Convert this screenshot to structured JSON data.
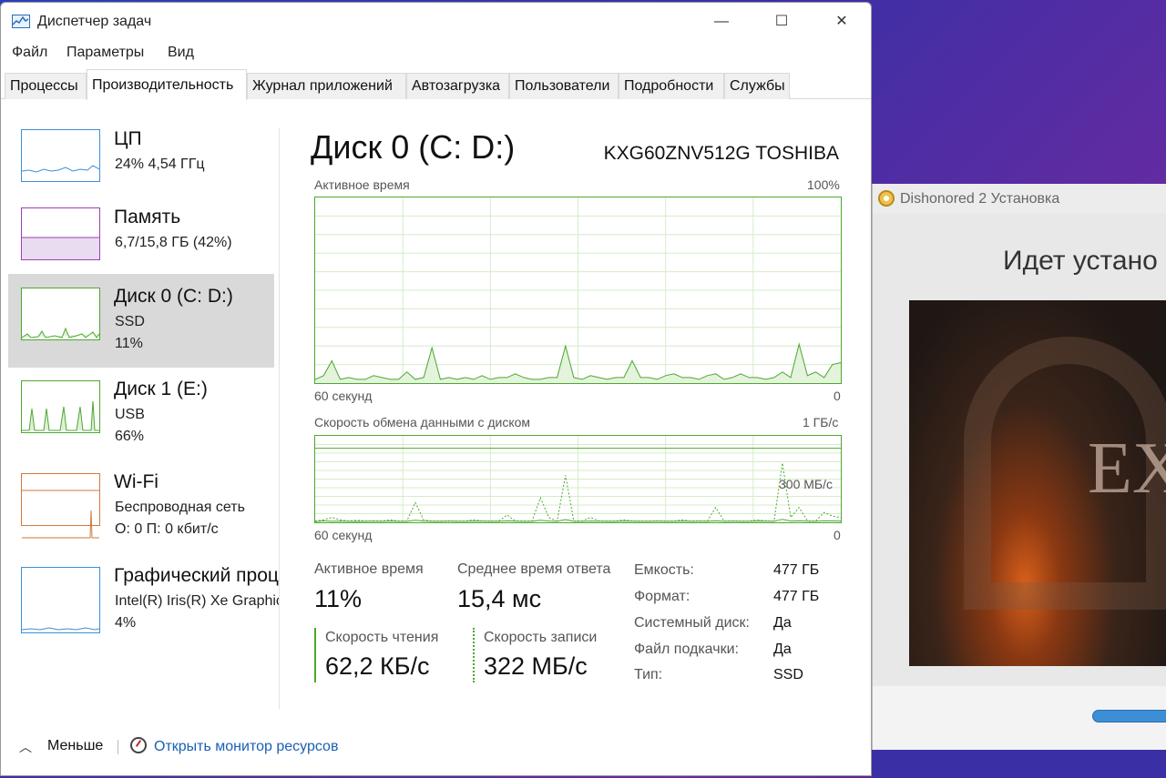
{
  "window": {
    "title": "Диспетчер задач",
    "controls": {
      "minimize": "—",
      "maximize": "☐",
      "close": "✕"
    }
  },
  "menu": [
    "Файл",
    "Параметры",
    "Вид"
  ],
  "tabs": [
    {
      "label": "Процессы",
      "active": false
    },
    {
      "label": "Производительность",
      "active": true
    },
    {
      "label": "Журнал приложений",
      "active": false
    },
    {
      "label": "Автозагрузка",
      "active": false
    },
    {
      "label": "Пользователи",
      "active": false
    },
    {
      "label": "Подробности",
      "active": false
    },
    {
      "label": "Службы",
      "active": false
    }
  ],
  "sidebar": {
    "items": [
      {
        "name": "ЦП",
        "line1": "24%  4,54 ГГц",
        "line2": "",
        "color": "#3c8fd4",
        "selected": false
      },
      {
        "name": "Память",
        "line1": "6,7/15,8 ГБ (42%)",
        "line2": "",
        "color": "#9b3fb5",
        "selected": false
      },
      {
        "name": "Диск 0 (C: D:)",
        "line1": "SSD",
        "line2": "11%",
        "color": "#4ca82e",
        "selected": true
      },
      {
        "name": "Диск 1 (E:)",
        "line1": "USB",
        "line2": "66%",
        "color": "#4ca82e",
        "selected": false
      },
      {
        "name": "Wi-Fi",
        "line1": "Беспроводная сеть",
        "line2": "О: 0  П: 0 кбит/с",
        "color": "#d27a3a",
        "selected": false
      },
      {
        "name": "Графический процессор",
        "line1": "Intel(R) Iris(R) Xe Graphics",
        "line2": "4%",
        "color": "#3c8fd4",
        "selected": false
      }
    ]
  },
  "main": {
    "title": "Диск 0 (C: D:)",
    "model": "KXG60ZNV512G TOSHIBA",
    "graph1": {
      "label": "Активное время",
      "max": "100%",
      "time": "60 секунд",
      "min": "0",
      "values": [
        2,
        4,
        12,
        2,
        3,
        2,
        2,
        4,
        3,
        2,
        2,
        6,
        2,
        3,
        19,
        2,
        3,
        2,
        3,
        2,
        4,
        2,
        3,
        3,
        5,
        3,
        2,
        2,
        3,
        3,
        20,
        3,
        2,
        4,
        3,
        2,
        3,
        3,
        12,
        3,
        3,
        2,
        4,
        5,
        3,
        3,
        2,
        4,
        5,
        2,
        3,
        5,
        3,
        3,
        2,
        3,
        6,
        3,
        21,
        4,
        6,
        3,
        10,
        11
      ],
      "ylim": [
        0,
        100
      ]
    },
    "graph2": {
      "label": "Скорость обмена данными с диском",
      "max": "1 ГБ/с",
      "mid": "300 МБ/с",
      "time": "60 секунд",
      "min": "0",
      "read": [
        15,
        30,
        20,
        25,
        20,
        18,
        20,
        22,
        20,
        25,
        20,
        20,
        40,
        25,
        20,
        20,
        22,
        20,
        20,
        25,
        22,
        20,
        20,
        30,
        22,
        20,
        20,
        40,
        25,
        20,
        55,
        20,
        20,
        25,
        22,
        20,
        20,
        25,
        22,
        20,
        20,
        22,
        20,
        20,
        25,
        20,
        22,
        20,
        30,
        20,
        22,
        20,
        20,
        25,
        22,
        20,
        60,
        25,
        30,
        22,
        20,
        30,
        28,
        26
      ],
      "write": [
        5,
        10,
        20,
        10,
        5,
        8,
        5,
        6,
        5,
        10,
        5,
        5,
        80,
        10,
        5,
        5,
        6,
        5,
        5,
        10,
        6,
        5,
        5,
        30,
        6,
        5,
        5,
        100,
        20,
        5,
        190,
        5,
        5,
        20,
        6,
        5,
        5,
        10,
        6,
        5,
        5,
        6,
        5,
        5,
        10,
        5,
        6,
        5,
        60,
        5,
        6,
        5,
        5,
        10,
        6,
        5,
        240,
        20,
        60,
        6,
        5,
        40,
        25,
        20
      ],
      "ylim_mb": [
        0,
        350
      ]
    },
    "stats": {
      "active_time_label": "Активное время",
      "active_time_value": "11%",
      "response_label": "Среднее время ответа",
      "response_value": "15,4 мс",
      "read_label": "Скорость чтения",
      "read_value": "62,2 КБ/с",
      "write_label": "Скорость записи",
      "write_value": "322 МБ/с"
    },
    "properties": [
      {
        "label": "Емкость:",
        "value": "477 ГБ"
      },
      {
        "label": "Формат:",
        "value": "477 ГБ"
      },
      {
        "label": "Системный диск:",
        "value": "Да"
      },
      {
        "label": "Файл подкачки:",
        "value": "Да"
      },
      {
        "label": "Тип:",
        "value": "SSD"
      }
    ]
  },
  "footer": {
    "less": "Меньше",
    "resource_monitor": "Открыть монитор ресурсов"
  },
  "installer": {
    "title": "Dishonored 2 Установка",
    "heading": "Идет устано",
    "art_text": "EX",
    "progress": 1.0
  }
}
